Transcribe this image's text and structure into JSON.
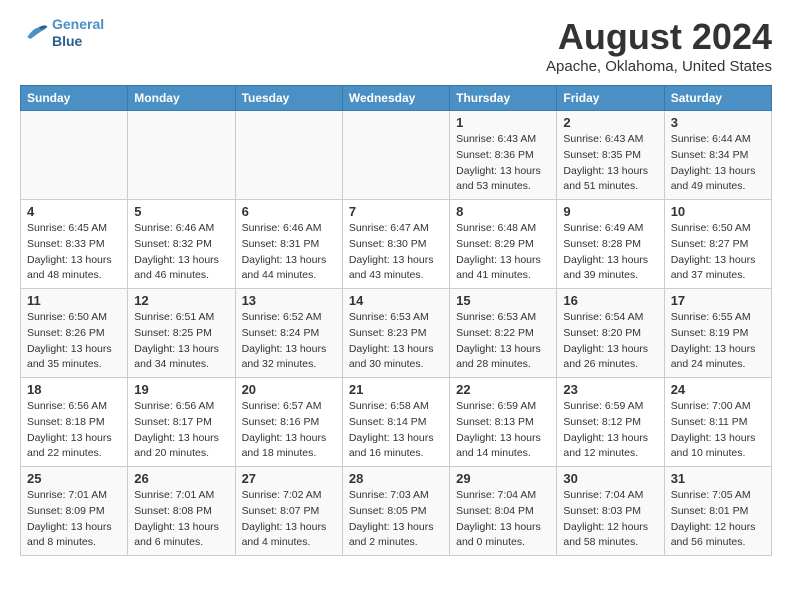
{
  "header": {
    "logo_line1": "General",
    "logo_line2": "Blue",
    "month": "August 2024",
    "location": "Apache, Oklahoma, United States"
  },
  "weekdays": [
    "Sunday",
    "Monday",
    "Tuesday",
    "Wednesday",
    "Thursday",
    "Friday",
    "Saturday"
  ],
  "weeks": [
    [
      null,
      null,
      null,
      null,
      {
        "day": "1",
        "sunrise": "6:43 AM",
        "sunset": "8:36 PM",
        "daylight": "13 hours and 53 minutes."
      },
      {
        "day": "2",
        "sunrise": "6:43 AM",
        "sunset": "8:35 PM",
        "daylight": "13 hours and 51 minutes."
      },
      {
        "day": "3",
        "sunrise": "6:44 AM",
        "sunset": "8:34 PM",
        "daylight": "13 hours and 49 minutes."
      }
    ],
    [
      {
        "day": "4",
        "sunrise": "6:45 AM",
        "sunset": "8:33 PM",
        "daylight": "13 hours and 48 minutes."
      },
      {
        "day": "5",
        "sunrise": "6:46 AM",
        "sunset": "8:32 PM",
        "daylight": "13 hours and 46 minutes."
      },
      {
        "day": "6",
        "sunrise": "6:46 AM",
        "sunset": "8:31 PM",
        "daylight": "13 hours and 44 minutes."
      },
      {
        "day": "7",
        "sunrise": "6:47 AM",
        "sunset": "8:30 PM",
        "daylight": "13 hours and 43 minutes."
      },
      {
        "day": "8",
        "sunrise": "6:48 AM",
        "sunset": "8:29 PM",
        "daylight": "13 hours and 41 minutes."
      },
      {
        "day": "9",
        "sunrise": "6:49 AM",
        "sunset": "8:28 PM",
        "daylight": "13 hours and 39 minutes."
      },
      {
        "day": "10",
        "sunrise": "6:50 AM",
        "sunset": "8:27 PM",
        "daylight": "13 hours and 37 minutes."
      }
    ],
    [
      {
        "day": "11",
        "sunrise": "6:50 AM",
        "sunset": "8:26 PM",
        "daylight": "13 hours and 35 minutes."
      },
      {
        "day": "12",
        "sunrise": "6:51 AM",
        "sunset": "8:25 PM",
        "daylight": "13 hours and 34 minutes."
      },
      {
        "day": "13",
        "sunrise": "6:52 AM",
        "sunset": "8:24 PM",
        "daylight": "13 hours and 32 minutes."
      },
      {
        "day": "14",
        "sunrise": "6:53 AM",
        "sunset": "8:23 PM",
        "daylight": "13 hours and 30 minutes."
      },
      {
        "day": "15",
        "sunrise": "6:53 AM",
        "sunset": "8:22 PM",
        "daylight": "13 hours and 28 minutes."
      },
      {
        "day": "16",
        "sunrise": "6:54 AM",
        "sunset": "8:20 PM",
        "daylight": "13 hours and 26 minutes."
      },
      {
        "day": "17",
        "sunrise": "6:55 AM",
        "sunset": "8:19 PM",
        "daylight": "13 hours and 24 minutes."
      }
    ],
    [
      {
        "day": "18",
        "sunrise": "6:56 AM",
        "sunset": "8:18 PM",
        "daylight": "13 hours and 22 minutes."
      },
      {
        "day": "19",
        "sunrise": "6:56 AM",
        "sunset": "8:17 PM",
        "daylight": "13 hours and 20 minutes."
      },
      {
        "day": "20",
        "sunrise": "6:57 AM",
        "sunset": "8:16 PM",
        "daylight": "13 hours and 18 minutes."
      },
      {
        "day": "21",
        "sunrise": "6:58 AM",
        "sunset": "8:14 PM",
        "daylight": "13 hours and 16 minutes."
      },
      {
        "day": "22",
        "sunrise": "6:59 AM",
        "sunset": "8:13 PM",
        "daylight": "13 hours and 14 minutes."
      },
      {
        "day": "23",
        "sunrise": "6:59 AM",
        "sunset": "8:12 PM",
        "daylight": "13 hours and 12 minutes."
      },
      {
        "day": "24",
        "sunrise": "7:00 AM",
        "sunset": "8:11 PM",
        "daylight": "13 hours and 10 minutes."
      }
    ],
    [
      {
        "day": "25",
        "sunrise": "7:01 AM",
        "sunset": "8:09 PM",
        "daylight": "13 hours and 8 minutes."
      },
      {
        "day": "26",
        "sunrise": "7:01 AM",
        "sunset": "8:08 PM",
        "daylight": "13 hours and 6 minutes."
      },
      {
        "day": "27",
        "sunrise": "7:02 AM",
        "sunset": "8:07 PM",
        "daylight": "13 hours and 4 minutes."
      },
      {
        "day": "28",
        "sunrise": "7:03 AM",
        "sunset": "8:05 PM",
        "daylight": "13 hours and 2 minutes."
      },
      {
        "day": "29",
        "sunrise": "7:04 AM",
        "sunset": "8:04 PM",
        "daylight": "13 hours and 0 minutes."
      },
      {
        "day": "30",
        "sunrise": "7:04 AM",
        "sunset": "8:03 PM",
        "daylight": "12 hours and 58 minutes."
      },
      {
        "day": "31",
        "sunrise": "7:05 AM",
        "sunset": "8:01 PM",
        "daylight": "12 hours and 56 minutes."
      }
    ]
  ]
}
